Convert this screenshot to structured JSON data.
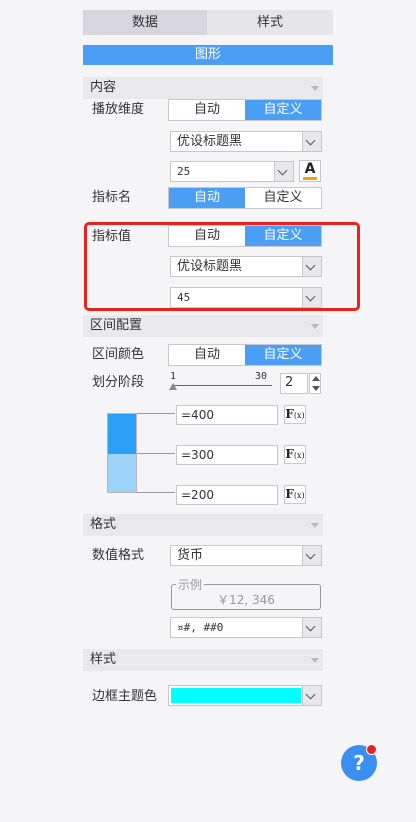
{
  "tabs": {
    "data": "数据",
    "style": "样式"
  },
  "title": "图形",
  "content_section": {
    "title": "内容",
    "play_dimension": {
      "label": "播放维度",
      "auto": "自动",
      "custom": "自定义"
    },
    "font_select": "优设标题黑",
    "font_size": "25",
    "font_color_icon": "A",
    "indicator_name": {
      "label": "指标名",
      "auto": "自动",
      "custom": "自定义"
    },
    "indicator_value": {
      "label": "指标值",
      "auto": "自动",
      "custom": "自定义",
      "font": "优设标题黑",
      "size": "45"
    }
  },
  "interval_section": {
    "title": "区间配置",
    "color": {
      "label": "区间颜色",
      "auto": "自动",
      "custom": "自定义"
    },
    "stages": {
      "label": "划分阶段",
      "min": "1",
      "max": "30",
      "value": "2"
    },
    "thresholds": [
      "=400",
      "=300",
      "=200"
    ],
    "fx_label": "F",
    "fx_sub": "(x)",
    "band_colors": [
      "#2a9ff5",
      "#9ed3fa"
    ]
  },
  "format_section": {
    "title": "格式",
    "number_format": {
      "label": "数值格式",
      "value": "货币"
    },
    "example_legend": "示例",
    "example_value": "￥12, 346",
    "pattern": "¤#, ##0"
  },
  "style_section": {
    "title": "样式",
    "border_theme": {
      "label": "边框主题色",
      "color": "#00ffff"
    }
  },
  "help": {
    "icon": "?"
  },
  "accent_color": "#4a9ff5",
  "highlight_color": "#e8231f"
}
